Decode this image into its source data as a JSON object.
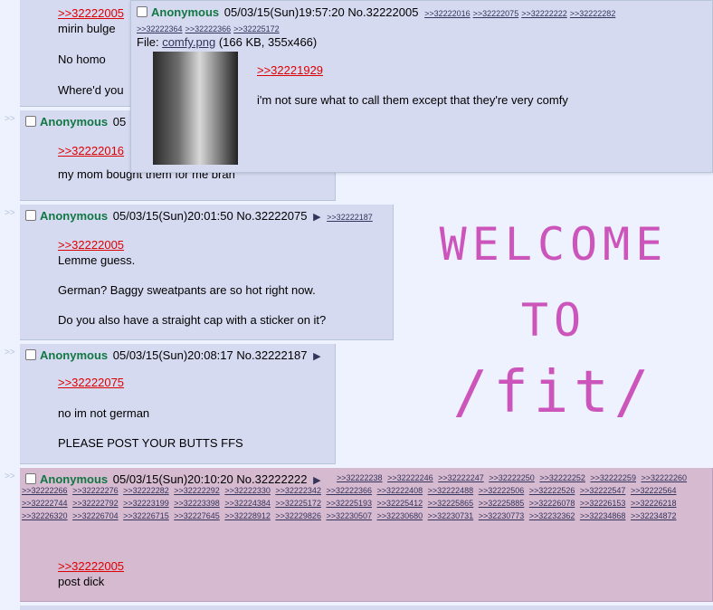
{
  "post_top": {
    "quote": ">>32222005",
    "lines": [
      "mirin bulge",
      "No homo",
      "Where'd you"
    ]
  },
  "post_comfy": {
    "name": "Anonymous",
    "datetime_no": "05",
    "quote": ">>32222016",
    "line": "my mom bought them for me brah"
  },
  "popup": {
    "name": "Anonymous",
    "datetime": "05/03/15(Sun)19:57:20",
    "number": "No.32222005",
    "backlinks_row1": [
      ">>32222016",
      ">>32222075",
      ">>32222222",
      ">>32222282"
    ],
    "backlinks_row2": [
      ">>32222364",
      ">>32222366",
      ">>32225172"
    ],
    "file_label": "File:",
    "file_name": "comfy.png",
    "file_info": "(166 KB, 355x466)",
    "quote": ">>32221929",
    "text": "i'm not sure what to call them except that they're very comfy"
  },
  "post_german": {
    "name": "Anonymous",
    "datetime": "05/03/15(Sun)20:01:50",
    "number": "No.32222075",
    "backlink": ">>32222187",
    "quote": ">>32222005",
    "lines": [
      "Lemme guess.",
      "German? Baggy sweatpants are so hot right now.",
      "Do you also have a straight cap with a sticker on it?"
    ]
  },
  "post_butts": {
    "name": "Anonymous",
    "datetime": "05/03/15(Sun)20:08:17",
    "number": "No.32222187",
    "quote": ">>32222075",
    "lines": [
      "no im not german",
      "PLEASE POST YOUR BUTTS FFS"
    ]
  },
  "post_dick": {
    "name": "Anonymous",
    "datetime": "05/03/15(Sun)20:10:20",
    "number": "No.32222222",
    "backlinks": [
      ">>32222238",
      ">>32222246",
      ">>32222247",
      ">>32222250",
      ">>32222252",
      ">>32222259",
      ">>32222260",
      ">>32222266",
      ">>32222276",
      ">>32222282",
      ">>32222292",
      ">>32222330",
      ">>32222342",
      ">>32222366",
      ">>32222408",
      ">>32222488",
      ">>32222506",
      ">>32222526",
      ">>32222547",
      ">>32222564",
      ">>32222744",
      ">>32222792",
      ">>32223199",
      ">>32223398",
      ">>32224384",
      ">>32225172",
      ">>32225193",
      ">>32225412",
      ">>32225865",
      ">>32225885",
      ">>32226078",
      ">>32226153",
      ">>32226218",
      ">>32226320",
      ">>32226704",
      ">>32226715",
      ">>32227645",
      ">>32228912",
      ">>32229826",
      ">>32230507",
      ">>32230680",
      ">>32230731",
      ">>32230773",
      ">>32232362",
      ">>32234868",
      ">>32234872"
    ],
    "quote": ">>32222005",
    "line": "post dick"
  },
  "arrow_glyph": ">>",
  "welcome": [
    "WELCOME",
    "TO",
    "/fit/"
  ],
  "colors": {
    "name": "#117743",
    "quote": "#dd0000",
    "post_bg": "#d6daf0",
    "highlight_bg": "#d6bad0",
    "welcome": "#cc55bb"
  }
}
